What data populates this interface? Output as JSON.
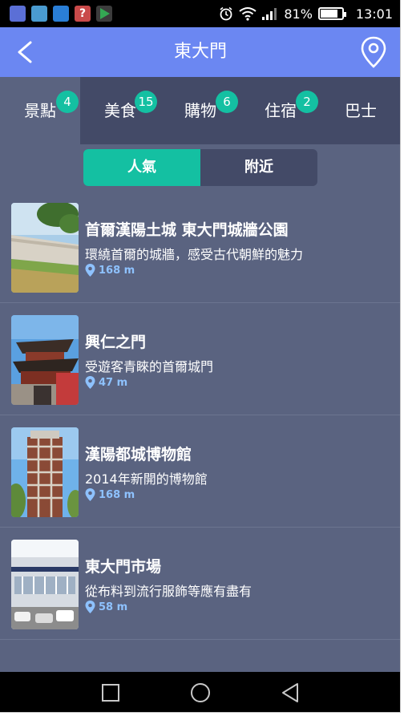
{
  "status_bar": {
    "battery_percent": "81%",
    "battery_level": 0.81,
    "time": "13:01",
    "notification_icons": [
      "app-icon",
      "gallery-icon",
      "dropbox-icon",
      "help-icon",
      "play-store-icon"
    ]
  },
  "app_bar": {
    "title": "東大門",
    "color": "#6b87f2"
  },
  "category_tabs": [
    {
      "label": "景點",
      "badge": "4",
      "active": true
    },
    {
      "label": "美食",
      "badge": "15",
      "active": false
    },
    {
      "label": "購物",
      "badge": "6",
      "active": false
    },
    {
      "label": "住宿",
      "badge": "2",
      "active": false
    },
    {
      "label": "巴士",
      "badge": "",
      "active": false
    }
  ],
  "sort_toggle": {
    "popular": "人氣",
    "nearby": "附近",
    "selected": "人氣"
  },
  "places": [
    {
      "title": "首爾漢陽土城 東大門城牆公園",
      "subtitle": "環繞首爾的城牆，感受古代朝鮮的魅力",
      "distance": "168 m"
    },
    {
      "title": "興仁之門",
      "subtitle": "受遊客青睞的首爾城門",
      "distance": "47 m"
    },
    {
      "title": "漢陽都城博物館",
      "subtitle": "2014年新開的博物館",
      "distance": "168 m"
    },
    {
      "title": "東大門市場",
      "subtitle": "從布料到流行服飾等應有盡有",
      "distance": "58 m"
    }
  ],
  "colors": {
    "background": "#5a6380",
    "tab_bar": "#434a67",
    "accent": "#14c0a2",
    "distance_text": "#8ec2ff"
  }
}
